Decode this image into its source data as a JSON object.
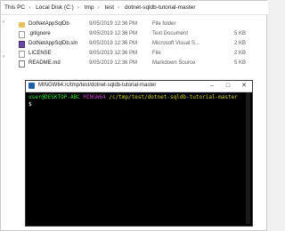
{
  "breadcrumb": [
    "This PC",
    "Local Disk (C:)",
    "tmp",
    "test",
    "dotnet-sqldb-tutorial-master"
  ],
  "breadcrumb_separator": "›",
  "files": [
    {
      "name": "DotNetAppSqlDb",
      "date": "9/05/2019 12:36 PM",
      "type": "File folder",
      "size": "",
      "icon": "folder-icon"
    },
    {
      "name": ".gitignore",
      "date": "9/05/2019 12:36 PM",
      "type": "Text Document",
      "size": "5 KB",
      "icon": "document-icon"
    },
    {
      "name": "DotNetAppSqlDb.sln",
      "date": "9/05/2019 12:36 PM",
      "type": "Microsoft Visual S...",
      "size": "2 KB",
      "icon": "solution-icon"
    },
    {
      "name": "LICENSE",
      "date": "9/05/2019 12:36 PM",
      "type": "File",
      "size": "2 KB",
      "icon": "document-icon"
    },
    {
      "name": "README.md",
      "date": "9/05/2019 12:36 PM",
      "type": "Markdown Source",
      "size": "5 KB",
      "icon": "markdown-icon"
    }
  ],
  "terminal": {
    "title": "MINGW64:/c/tmp/test/dotnet-sqldb-tutorial-master",
    "prompt_user": "user@DESKTOP-ABC",
    "prompt_host": "MINGW64",
    "prompt_path": "/c/tmp/test/dotnet-sqldb-tutorial-master",
    "prompt_symbol": "$"
  }
}
